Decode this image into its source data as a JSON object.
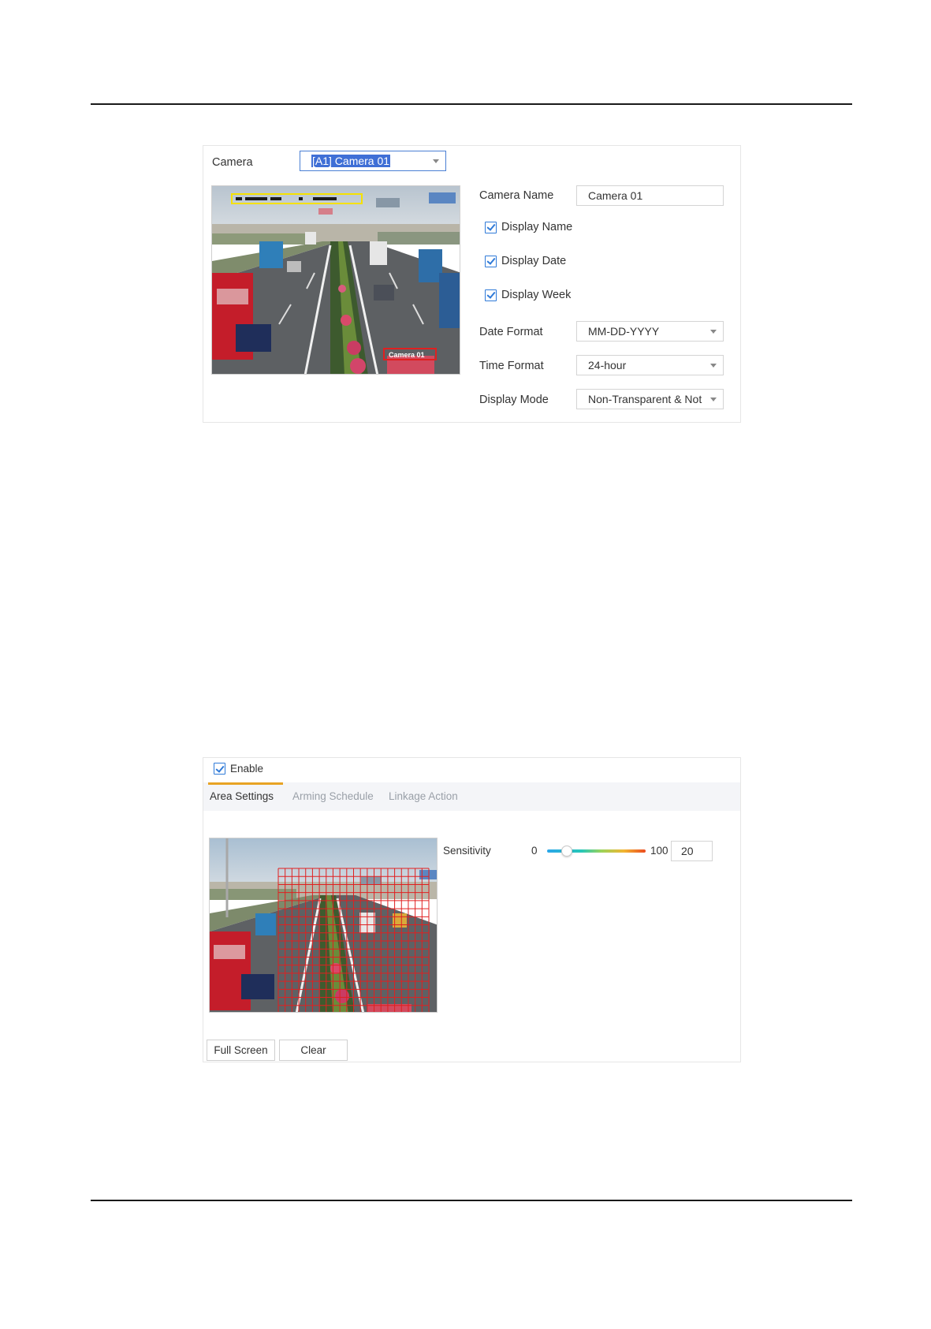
{
  "osd": {
    "camera_label": "Camera",
    "camera_value": "[A1] Camera 01",
    "camera_name_label": "Camera Name",
    "camera_name_value": "Camera 01",
    "checks": [
      {
        "label": "Display Name",
        "checked": true
      },
      {
        "label": "Display Date",
        "checked": true
      },
      {
        "label": "Display Week",
        "checked": true
      }
    ],
    "date_format_label": "Date Format",
    "date_format_value": "MM-DD-YYYY",
    "time_format_label": "Time Format",
    "time_format_value": "24-hour",
    "display_mode_label": "Display Mode",
    "display_mode_value": "Non-Transparent & Not",
    "overlay_name_text": "Camera 01"
  },
  "motion": {
    "enable_label": "Enable",
    "enable_checked": true,
    "tabs": [
      "Area Settings",
      "Arming Schedule",
      "Linkage Action"
    ],
    "active_tab": "Area Settings",
    "sensitivity_label": "Sensitivity",
    "slider_min": "0",
    "slider_max": "100",
    "sensitivity_value": "20",
    "sensitivity_fraction": 0.2,
    "full_screen_label": "Full Screen",
    "clear_label": "Clear"
  },
  "colors": {
    "accent_blue": "#2f7ad8",
    "tab_underline": "#e8a324",
    "grid_red": "#e02020",
    "osd_yellow": "#f5e100"
  },
  "icons": [
    "dropdown-caret-icon",
    "checkbox-checked-icon"
  ]
}
